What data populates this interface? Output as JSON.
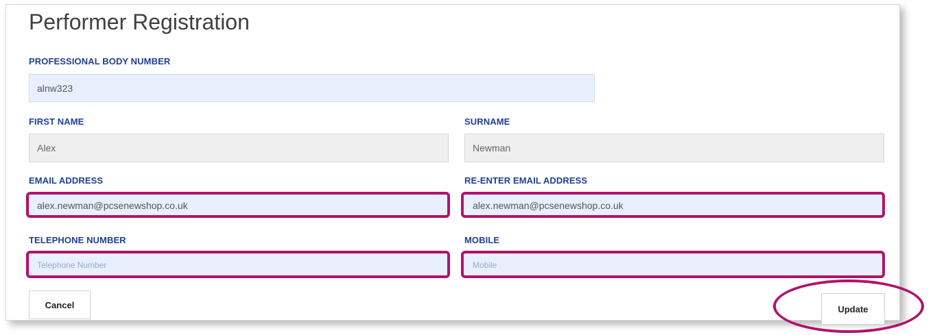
{
  "page": {
    "title": "Performer Registration"
  },
  "form": {
    "professional_body_number": {
      "label": "PROFESSIONAL BODY NUMBER",
      "value": "alnw323",
      "placeholder": ""
    },
    "first_name": {
      "label": "FIRST NAME",
      "value": "Alex",
      "placeholder": ""
    },
    "surname": {
      "label": "SURNAME",
      "value": "Newman",
      "placeholder": ""
    },
    "email": {
      "label": "EMAIL ADDRESS",
      "value": "alex.newman@pcsenewshop.co.uk",
      "placeholder": ""
    },
    "email_confirm": {
      "label": "RE-ENTER EMAIL ADDRESS",
      "value": "alex.newman@pcsenewshop.co.uk",
      "placeholder": ""
    },
    "telephone": {
      "label": "TELEPHONE NUMBER",
      "value": "",
      "placeholder": "Telephone Number"
    },
    "mobile": {
      "label": "MOBILE",
      "value": "",
      "placeholder": "Mobile"
    }
  },
  "buttons": {
    "cancel": "Cancel",
    "update": "Update"
  },
  "colors": {
    "label": "#1f3f93",
    "highlight": "#b0136b",
    "input_background": "#e8f0fe",
    "readonly_background": "#efefef"
  }
}
